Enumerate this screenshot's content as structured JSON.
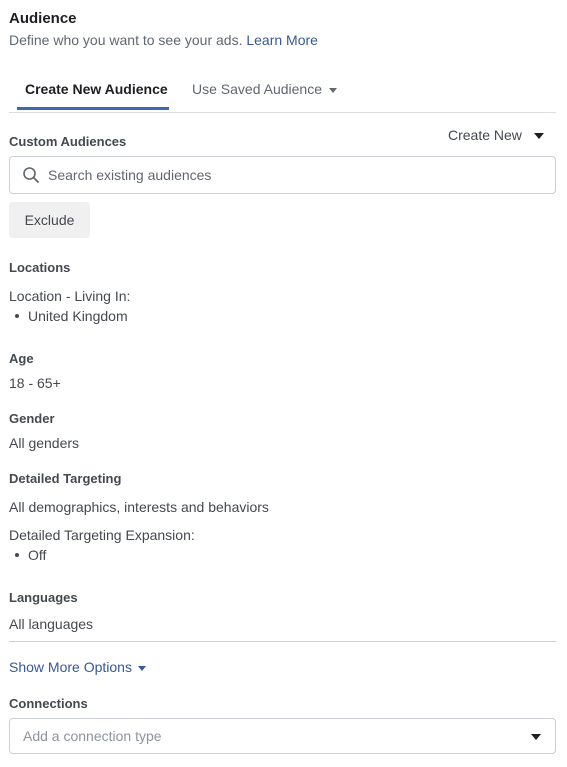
{
  "audience": {
    "title": "Audience",
    "subtitle": "Define who you want to see your ads.",
    "learn_more": "Learn More"
  },
  "tabs": [
    {
      "label": "Create New Audience",
      "active": true
    },
    {
      "label": "Use Saved Audience",
      "active": false
    }
  ],
  "custom_audiences": {
    "label": "Custom Audiences",
    "create_new": "Create New",
    "search_placeholder": "Search existing audiences",
    "exclude_label": "Exclude"
  },
  "locations": {
    "label": "Locations",
    "line": "Location - Living In:",
    "items": [
      "United Kingdom"
    ]
  },
  "age": {
    "label": "Age",
    "value": "18 - 65+"
  },
  "gender": {
    "label": "Gender",
    "value": "All genders"
  },
  "detailed_targeting": {
    "label": "Detailed Targeting",
    "value": "All demographics, interests and behaviors",
    "expansion_label": "Detailed Targeting Expansion:",
    "expansion_items": [
      "Off"
    ]
  },
  "languages": {
    "label": "Languages",
    "value": "All languages"
  },
  "show_more": "Show More Options",
  "connections": {
    "label": "Connections",
    "placeholder": "Add a connection type"
  },
  "colors": {
    "link": "#385898",
    "tab_underline": "#4267b2",
    "button_bg": "#f0f0f0"
  },
  "icons": {
    "search": "search-icon",
    "dropdown": "caret-down-icon"
  }
}
